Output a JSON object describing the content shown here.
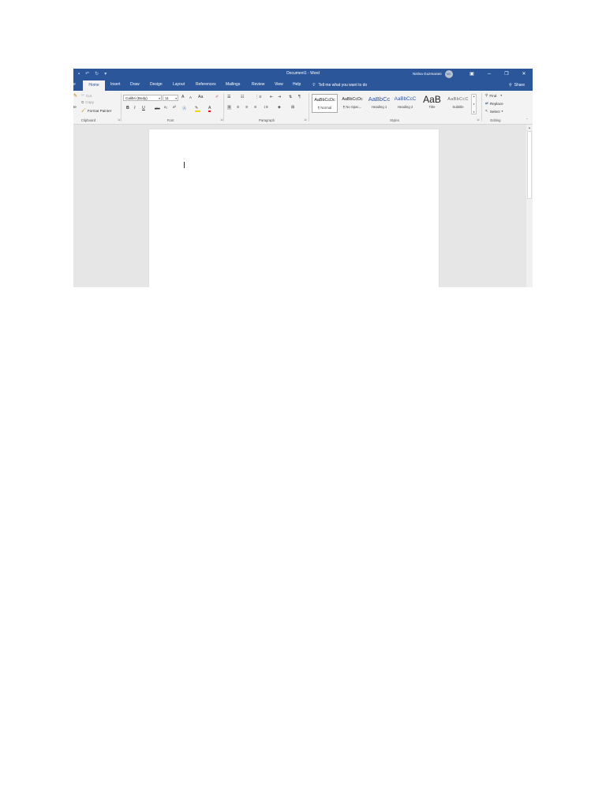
{
  "window": {
    "title": "Document1  -  Word",
    "user_name": "Nislna Guzmarani",
    "avatar_initials": "NG",
    "buttons": [
      "ribbon-display-icon",
      "minimize-icon",
      "restore-icon",
      "close-icon"
    ]
  },
  "quick_access": {
    "icons": [
      "save-icon",
      "undo-icon",
      "redo-icon",
      "customize-icon"
    ]
  },
  "tabs": {
    "file_partial": "e",
    "items": [
      "Home",
      "Insert",
      "Draw",
      "Design",
      "Layout",
      "References",
      "Mailings",
      "Review",
      "View",
      "Help"
    ],
    "active": "Home",
    "tell_me": "Tell me what you want to do",
    "share": "Share"
  },
  "clipboard": {
    "paste_partial": "te",
    "cut": "Cut",
    "copy": "Copy",
    "format_painter": "Format Painter",
    "label": "Clipboard"
  },
  "font": {
    "name": "Calibri (Body)",
    "size": "11",
    "grow": "A",
    "shrink": "A",
    "case": "Aa",
    "bold": "B",
    "italic": "I",
    "underline": "U",
    "strike": "abc",
    "subscript": "x₂",
    "superscript": "x²",
    "font_color": "A",
    "label": "Font"
  },
  "paragraph": {
    "label": "Paragraph",
    "show_marks": "¶"
  },
  "styles": {
    "label": "Styles",
    "items": [
      {
        "sample": "AaBbCcDc",
        "name": "¶ Normal",
        "selected": true
      },
      {
        "sample": "AaBbCcDc",
        "name": "¶ No Spac..."
      },
      {
        "sample": "AaBbCc",
        "name": "Heading 1"
      },
      {
        "sample": "AaBbCcC",
        "name": "Heading 2"
      },
      {
        "sample": "AaB",
        "name": "Title"
      },
      {
        "sample": "AaBbCcC",
        "name": "Subtitle"
      }
    ]
  },
  "editing": {
    "find": "Find",
    "replace": "Replace",
    "select": "Select",
    "label": "Editing"
  },
  "colors": {
    "word_blue": "#2b579a",
    "ribbon_bg": "#f3f3f3",
    "canvas_bg": "#e6e6e6",
    "highlight_yellow": "#f2d600",
    "font_red": "#e81123"
  }
}
